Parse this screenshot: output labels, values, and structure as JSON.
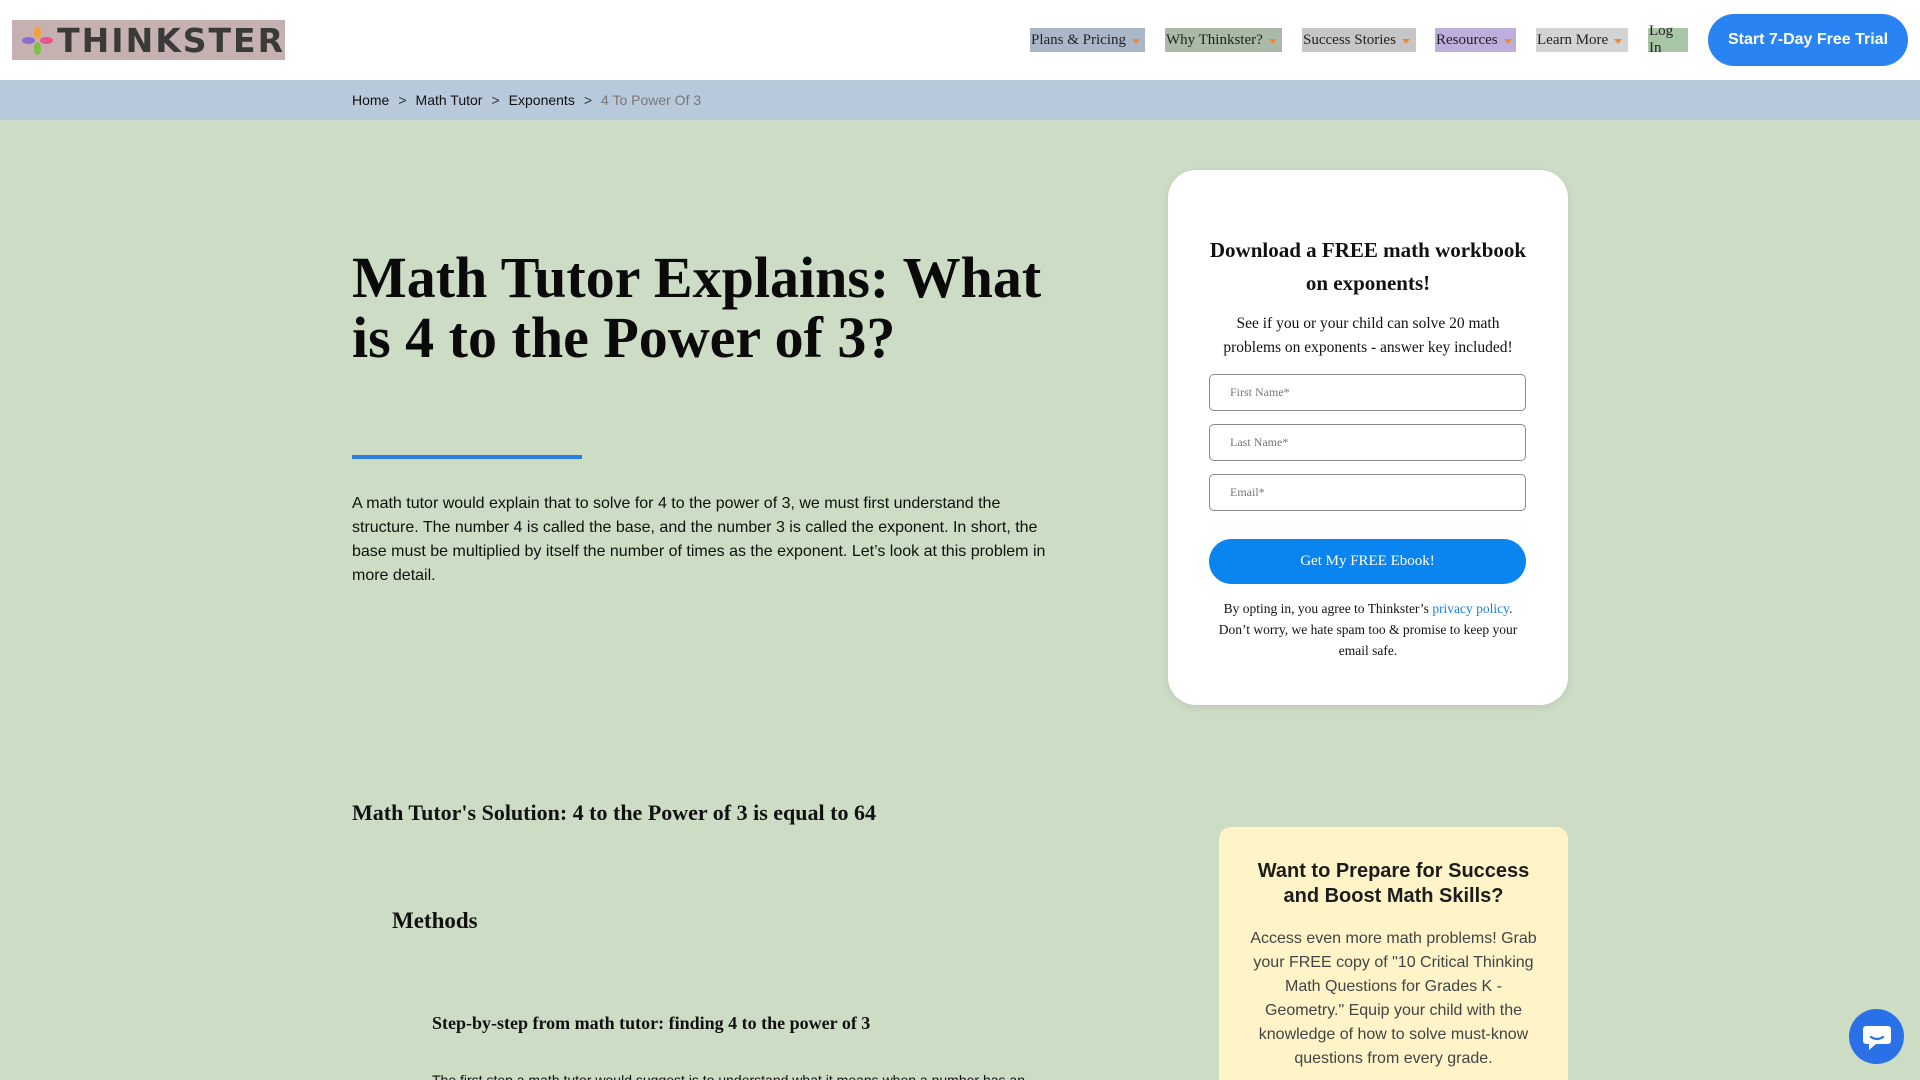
{
  "header": {
    "logo_text": "THINKSTER",
    "nav": [
      {
        "label": "Plans & Pricing"
      },
      {
        "label": "Why Thinkster?"
      },
      {
        "label": "Success Stories"
      },
      {
        "label": "Resources"
      },
      {
        "label": "Learn More"
      },
      {
        "label": "Log In"
      }
    ],
    "cta_label": "Start 7-Day Free Trial"
  },
  "breadcrumb": {
    "items": [
      "Home",
      "Math Tutor",
      "Exponents"
    ],
    "separator": ">",
    "current": "4 To Power Of 3"
  },
  "main": {
    "title": "Math Tutor Explains: What is 4 to the Power of 3?",
    "intro": "A math tutor would explain that to solve for 4 to the power of 3, we must first understand the structure. The number 4 is called the base, and the number 3 is called the exponent. In short, the base must be multiplied by itself the number of times as the exponent. Let’s look at this problem in more detail.",
    "solution_heading": "Math Tutor's Solution: 4 to the Power of 3 is equal to 64",
    "methods_heading": "Methods",
    "step_heading": "Step-by-step from math tutor: finding 4 to the power of 3",
    "step_text": "The first step a math tutor would suggest is to understand what it means when a number has an"
  },
  "form": {
    "title": "Download a FREE math workbook on exponents!",
    "subtitle": "See if you or your child can solve 20 math problems on exponents - answer key included!",
    "first_name_placeholder": "First Name*",
    "last_name_placeholder": "Last Name*",
    "email_placeholder": "Email*",
    "submit_label": "Get My FREE Ebook!",
    "legal_prefix": "By opting in, you agree to Thinkster’s ",
    "legal_link": "privacy policy",
    "legal_suffix": ". Don’t worry, we hate spam too & promise to keep your email safe."
  },
  "promo": {
    "title": "Want to Prepare for Success and Boost Math Skills?",
    "text": "Access even more math problems! Grab your FREE copy of \"10 Critical Thinking Math Questions for Grades K - Geometry.\" Equip your child with the knowledge of how to solve must-know questions from every grade."
  },
  "icons": {
    "logo": "thinkster-flower-logo",
    "nav_caret": "caret-down-icon",
    "chat": "chat-bubble-icon"
  },
  "colors": {
    "page_bg": "#cddcc5",
    "breadcrumb_bg": "#b8c9dc",
    "accent_blue": "#2a83f2",
    "caret_orange": "#f08a2e",
    "promo_bg": "#fef4c8"
  }
}
